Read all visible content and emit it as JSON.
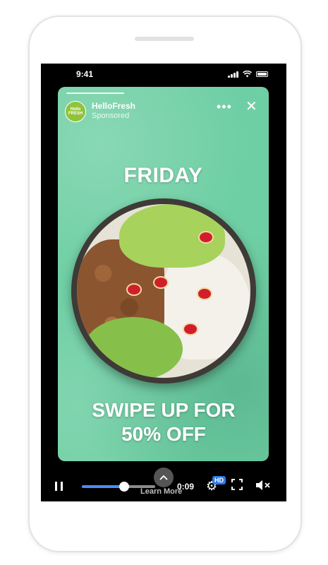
{
  "status_bar": {
    "time": "9:41"
  },
  "story": {
    "brand_name": "HelloFresh",
    "sponsored_label": "Sponsored",
    "logo_text": "Hello FRESH",
    "more_label": "•••",
    "close_label": "✕",
    "headline_top": "FRIDAY",
    "headline_bottom": "SWIPE UP FOR 50% OFF",
    "progress_fraction": 0.28,
    "background_color": "#6fcfa4"
  },
  "player": {
    "seek_fraction": 0.58,
    "timecode": "0:09",
    "learn_more_label": "Learn More",
    "hd_badge": "HD",
    "accent_color": "#4a8cff",
    "icons": [
      "pause-icon",
      "chevron-up-icon",
      "gear-icon",
      "fullscreen-icon",
      "mute-icon"
    ]
  }
}
